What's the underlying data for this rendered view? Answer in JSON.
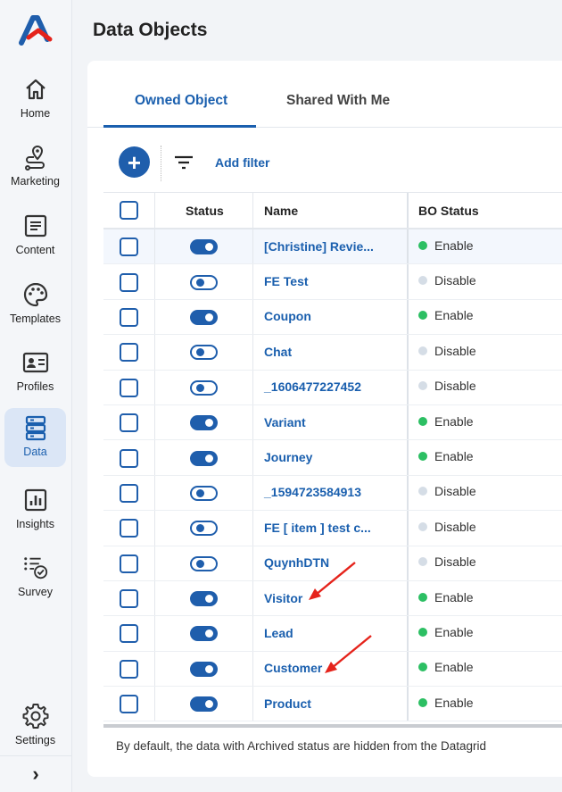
{
  "sidebar": {
    "items": [
      {
        "label": "Home",
        "icon": "home-icon"
      },
      {
        "label": "Marketing",
        "icon": "route-pin-icon"
      },
      {
        "label": "Content",
        "icon": "document-icon"
      },
      {
        "label": "Templates",
        "icon": "palette-icon"
      },
      {
        "label": "Profiles",
        "icon": "id-card-icon"
      },
      {
        "label": "Data",
        "icon": "database-icon",
        "active": true
      },
      {
        "label": "Insights",
        "icon": "bar-chart-icon"
      },
      {
        "label": "Survey",
        "icon": "checklist-icon"
      }
    ],
    "settings_label": "Settings",
    "expand_glyph": "›"
  },
  "page": {
    "title": "Data Objects"
  },
  "tabs": {
    "owned": "Owned Object",
    "shared": "Shared With Me"
  },
  "toolbar": {
    "add_glyph": "+",
    "add_filter": "Add filter"
  },
  "table": {
    "columns": {
      "status": "Status",
      "name": "Name",
      "bo_status": "BO Status"
    },
    "rows": [
      {
        "name": "[Christine] Revie...",
        "toggle": true,
        "bo_status": "Enable"
      },
      {
        "name": "FE Test",
        "toggle": false,
        "bo_status": "Disable"
      },
      {
        "name": "Coupon",
        "toggle": true,
        "bo_status": "Enable"
      },
      {
        "name": "Chat",
        "toggle": false,
        "bo_status": "Disable"
      },
      {
        "name": "_1606477227452",
        "toggle": false,
        "bo_status": "Disable"
      },
      {
        "name": "Variant",
        "toggle": true,
        "bo_status": "Enable"
      },
      {
        "name": "Journey",
        "toggle": true,
        "bo_status": "Enable"
      },
      {
        "name": "_1594723584913",
        "toggle": false,
        "bo_status": "Disable"
      },
      {
        "name": "FE [ item ] test c...",
        "toggle": false,
        "bo_status": "Disable"
      },
      {
        "name": "QuynhDTN",
        "toggle": false,
        "bo_status": "Disable"
      },
      {
        "name": "Visitor",
        "toggle": true,
        "bo_status": "Enable"
      },
      {
        "name": "Lead",
        "toggle": true,
        "bo_status": "Enable"
      },
      {
        "name": "Customer",
        "toggle": true,
        "bo_status": "Enable"
      },
      {
        "name": "Product",
        "toggle": true,
        "bo_status": "Enable"
      }
    ]
  },
  "footnote": "By default, the data with Archived status are hidden from the Datagrid",
  "colors": {
    "accent": "#1f5eac",
    "enable": "#2cbf63",
    "disable": "#d5dde6",
    "annotation": "#e5231b"
  }
}
